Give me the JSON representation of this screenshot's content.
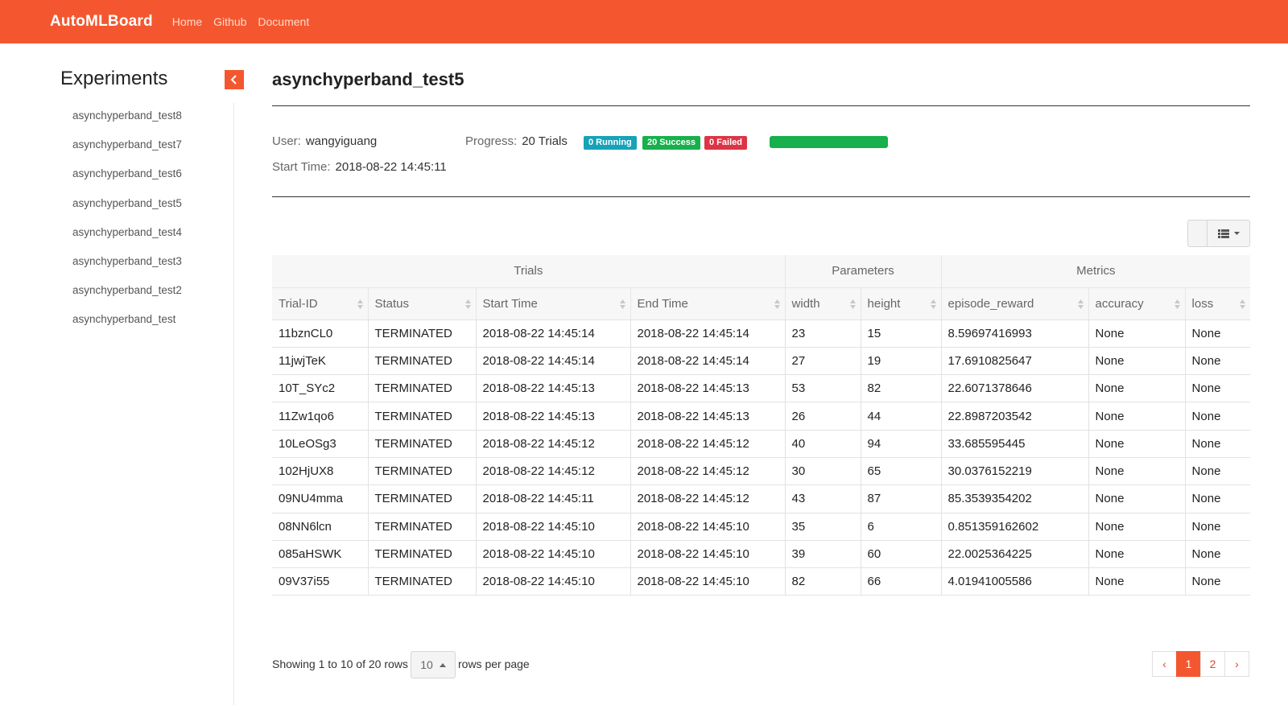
{
  "navbar": {
    "brand": "AutoMLBoard",
    "links": [
      "Home",
      "Github",
      "Document"
    ]
  },
  "sidebar": {
    "title": "Experiments",
    "experiments": [
      "asynchyperband_test8",
      "asynchyperband_test7",
      "asynchyperband_test6",
      "asynchyperband_test5",
      "asynchyperband_test4",
      "asynchyperband_test3",
      "asynchyperband_test2",
      "asynchyperband_test"
    ]
  },
  "experiment": {
    "title": "asynchyperband_test5",
    "user_label": "User:",
    "user": "wangyiguang",
    "progress_label": "Progress:",
    "progress_trials": "20 Trials",
    "running_badge": "0 Running",
    "success_badge": "20 Success",
    "failed_badge": "0 Failed",
    "progress_fraction": 1.0,
    "start_time_label": "Start Time:",
    "start_time": "2018-08-22 14:45:11"
  },
  "colors": {
    "brand": "#f4572f",
    "running": "#17a2b8",
    "success": "#17b04c",
    "failed": "#dc3545",
    "link": "#1a73c7"
  },
  "table": {
    "groups": [
      "Trials",
      "Parameters",
      "Metrics"
    ],
    "columns": [
      "Trial-ID",
      "Status",
      "Start Time",
      "End Time",
      "width",
      "height",
      "episode_reward",
      "accuracy",
      "loss"
    ],
    "rows": [
      [
        "11bznCL0",
        "TERMINATED",
        "2018-08-22 14:45:14",
        "2018-08-22 14:45:14",
        "23",
        "15",
        "8.59697416993",
        "None",
        "None"
      ],
      [
        "11jwjTeK",
        "TERMINATED",
        "2018-08-22 14:45:14",
        "2018-08-22 14:45:14",
        "27",
        "19",
        "17.6910825647",
        "None",
        "None"
      ],
      [
        "10T_SYc2",
        "TERMINATED",
        "2018-08-22 14:45:13",
        "2018-08-22 14:45:13",
        "53",
        "82",
        "22.6071378646",
        "None",
        "None"
      ],
      [
        "11Zw1qo6",
        "TERMINATED",
        "2018-08-22 14:45:13",
        "2018-08-22 14:45:13",
        "26",
        "44",
        "22.8987203542",
        "None",
        "None"
      ],
      [
        "10LeOSg3",
        "TERMINATED",
        "2018-08-22 14:45:12",
        "2018-08-22 14:45:12",
        "40",
        "94",
        "33.685595445",
        "None",
        "None"
      ],
      [
        "102HjUX8",
        "TERMINATED",
        "2018-08-22 14:45:12",
        "2018-08-22 14:45:12",
        "30",
        "65",
        "30.0376152219",
        "None",
        "None"
      ],
      [
        "09NU4mma",
        "TERMINATED",
        "2018-08-22 14:45:11",
        "2018-08-22 14:45:12",
        "43",
        "87",
        "85.3539354202",
        "None",
        "None"
      ],
      [
        "08NN6lcn",
        "TERMINATED",
        "2018-08-22 14:45:10",
        "2018-08-22 14:45:10",
        "35",
        "6",
        "0.851359162602",
        "None",
        "None"
      ],
      [
        "085aHSWK",
        "TERMINATED",
        "2018-08-22 14:45:10",
        "2018-08-22 14:45:10",
        "39",
        "60",
        "22.0025364225",
        "None",
        "None"
      ],
      [
        "09V37i55",
        "TERMINATED",
        "2018-08-22 14:45:10",
        "2018-08-22 14:45:10",
        "82",
        "66",
        "4.01941005586",
        "None",
        "None"
      ]
    ]
  },
  "footer": {
    "showing": "Showing 1 to 10 of 20 rows",
    "page_size": "10",
    "rows_per_page": "rows per page",
    "pagination": [
      "‹",
      "1",
      "2",
      "›"
    ],
    "active_page": "1"
  }
}
